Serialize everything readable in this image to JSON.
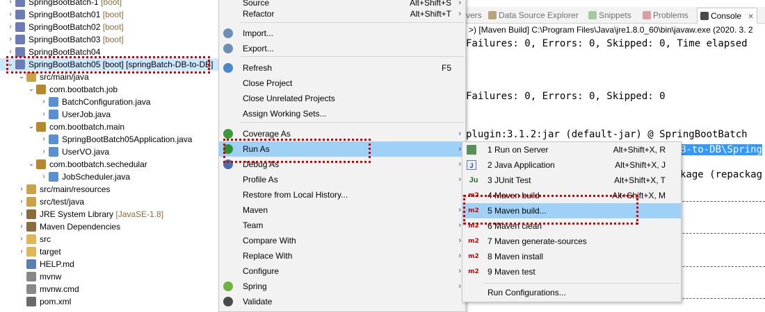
{
  "explorer": {
    "items": [
      {
        "name": "SpringBootBatch-1",
        "deco": " [boot]"
      },
      {
        "name": "SpringBootBatch01",
        "deco": " [boot]"
      },
      {
        "name": "SpringBootBatch02",
        "deco": " [boot]"
      },
      {
        "name": "SpringBootBatch03",
        "deco": " [boot]"
      },
      {
        "name": "SpringBootBatch04",
        "deco": ""
      },
      {
        "name": "SpringBootBatch05 [boot] [springBatch-DB-to-DB]",
        "deco": ""
      },
      {
        "name": "src/main/java",
        "deco": ""
      },
      {
        "name": "com.bootbatch.job",
        "deco": ""
      },
      {
        "name": "BatchConfiguration.java",
        "deco": ""
      },
      {
        "name": "UserJob.java",
        "deco": ""
      },
      {
        "name": "com.bootbatch.main",
        "deco": ""
      },
      {
        "name": "SpringBootBatch05Application.java",
        "deco": ""
      },
      {
        "name": "UserVO.java",
        "deco": ""
      },
      {
        "name": "com.bootbatch.sechedular",
        "deco": ""
      },
      {
        "name": "JobScheduler.java",
        "deco": ""
      },
      {
        "name": "src/main/resources",
        "deco": ""
      },
      {
        "name": "src/test/java",
        "deco": ""
      },
      {
        "name": "JRE System Library",
        "deco": " [JavaSE-1.8]"
      },
      {
        "name": "Maven Dependencies",
        "deco": ""
      },
      {
        "name": "src",
        "deco": ""
      },
      {
        "name": "target",
        "deco": ""
      },
      {
        "name": "HELP.md",
        "deco": ""
      },
      {
        "name": "mvnw",
        "deco": ""
      },
      {
        "name": "mvnw.cmd",
        "deco": ""
      },
      {
        "name": "pom.xml",
        "deco": ""
      }
    ]
  },
  "context_menu": {
    "items": [
      {
        "label": "Source",
        "shortcut": "Alt+Shift+S"
      },
      {
        "label": "Refactor",
        "shortcut": "Alt+Shift+T"
      },
      {
        "label": "Import...",
        "shortcut": ""
      },
      {
        "label": "Export...",
        "shortcut": ""
      },
      {
        "label": "Refresh",
        "shortcut": "F5"
      },
      {
        "label": "Close Project",
        "shortcut": ""
      },
      {
        "label": "Close Unrelated Projects",
        "shortcut": ""
      },
      {
        "label": "Assign Working Sets...",
        "shortcut": ""
      },
      {
        "label": "Coverage As",
        "shortcut": ""
      },
      {
        "label": "Run As",
        "shortcut": ""
      },
      {
        "label": "Debug As",
        "shortcut": ""
      },
      {
        "label": "Profile As",
        "shortcut": ""
      },
      {
        "label": "Restore from Local History...",
        "shortcut": ""
      },
      {
        "label": "Maven",
        "shortcut": ""
      },
      {
        "label": "Team",
        "shortcut": ""
      },
      {
        "label": "Compare With",
        "shortcut": ""
      },
      {
        "label": "Replace With",
        "shortcut": ""
      },
      {
        "label": "Configure",
        "shortcut": ""
      },
      {
        "label": "Spring",
        "shortcut": ""
      },
      {
        "label": "Validate",
        "shortcut": ""
      }
    ],
    "submenu_arrow": "›"
  },
  "run_as_menu": {
    "items": [
      {
        "label": "1 Run on Server",
        "shortcut": "Alt+Shift+X, R",
        "icon": "server-icon"
      },
      {
        "label": "2 Java Application",
        "shortcut": "Alt+Shift+X, J",
        "icon": "java-app-icon"
      },
      {
        "label": "3 JUnit Test",
        "shortcut": "Alt+Shift+X, T",
        "icon": "junit-icon"
      },
      {
        "label": "4 Maven build",
        "shortcut": "Alt+Shift+X, M",
        "icon": "m2-icon"
      },
      {
        "label": "5 Maven build...",
        "shortcut": "",
        "icon": "m2-icon"
      },
      {
        "label": "6 Maven clean",
        "shortcut": "",
        "icon": "m2-icon"
      },
      {
        "label": "7 Maven generate-sources",
        "shortcut": "",
        "icon": "m2-icon"
      },
      {
        "label": "8 Maven install",
        "shortcut": "",
        "icon": "m2-icon"
      },
      {
        "label": "9 Maven test",
        "shortcut": "",
        "icon": "m2-icon"
      },
      {
        "label": "Run Configurations...",
        "shortcut": "",
        "icon": ""
      }
    ],
    "m2_text": "m2",
    "junit_text": "Ju",
    "java_text": "J"
  },
  "console": {
    "tabs": [
      "vers",
      "Data Source Explorer",
      "Snippets",
      "Problems",
      "Console"
    ],
    "close_glyph": "✕",
    "path": ">) [Maven Build] C:\\Program Files\\Java\\jre1.8.0_60\\bin\\javaw.exe (2020. 3. 2",
    "lines": [
      "Failures: 0, Errors: 0, Skipped: 0, Time elapsed",
      "Failures: 0, Errors: 0, Skipped: 0",
      "plugin:3.1.2:jar (default-jar) @ SpringBootBatch",
      "B-to-DB\\Spring",
      "kage (repackag"
    ]
  },
  "colors": {
    "highlight_border": "#d40000",
    "menu_hover": "#9fd1f7",
    "selection": "#3399ff"
  }
}
